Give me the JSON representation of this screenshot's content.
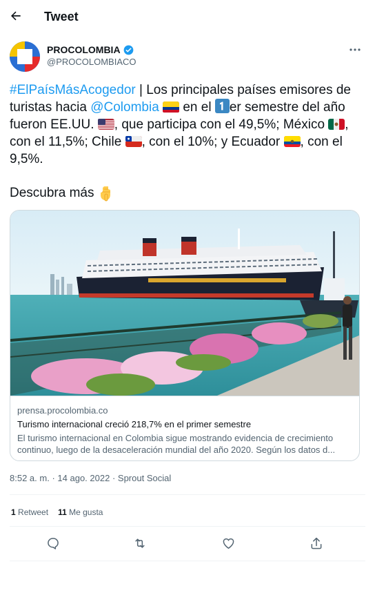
{
  "header": {
    "title": "Tweet"
  },
  "author": {
    "name": "PROCOLOMBIA",
    "handle": "@PROCOLOMBIACO",
    "verified": true
  },
  "tweet": {
    "hashtag": "#ElPaísMásAcogedor",
    "t1": " | Los principales países emisores de turistas hacia ",
    "mention": "@Colombia",
    "t2": " en el ",
    "t3": "er semestre del año fueron EE.UU. ",
    "t4": ", que participa con el 49,5%; México ",
    "t5": ", con el 11,5%; Chile ",
    "t6": ", con el 10%; y Ecuador ",
    "t7": ", con el 9,5%.",
    "more": "Descubra más"
  },
  "card": {
    "domain": "prensa.procolombia.co",
    "title": "Turismo internacional creció 218,7% en el primer semestre",
    "description": "El turismo internacional en Colombia sigue mostrando evidencia de crecimiento continuo, luego de la desaceleración mundial del año 2020. Según los datos d..."
  },
  "meta": {
    "time": "8:52 a. m.",
    "date": "14 ago. 2022",
    "source": "Sprout Social"
  },
  "stats": {
    "retweets": "1",
    "retweets_label": "Retweet",
    "likes": "11",
    "likes_label": "Me gusta"
  },
  "colors": {
    "accent": "#1d9bf0",
    "text": "#0f1419",
    "muted": "#536471",
    "border": "#cfd9de"
  }
}
